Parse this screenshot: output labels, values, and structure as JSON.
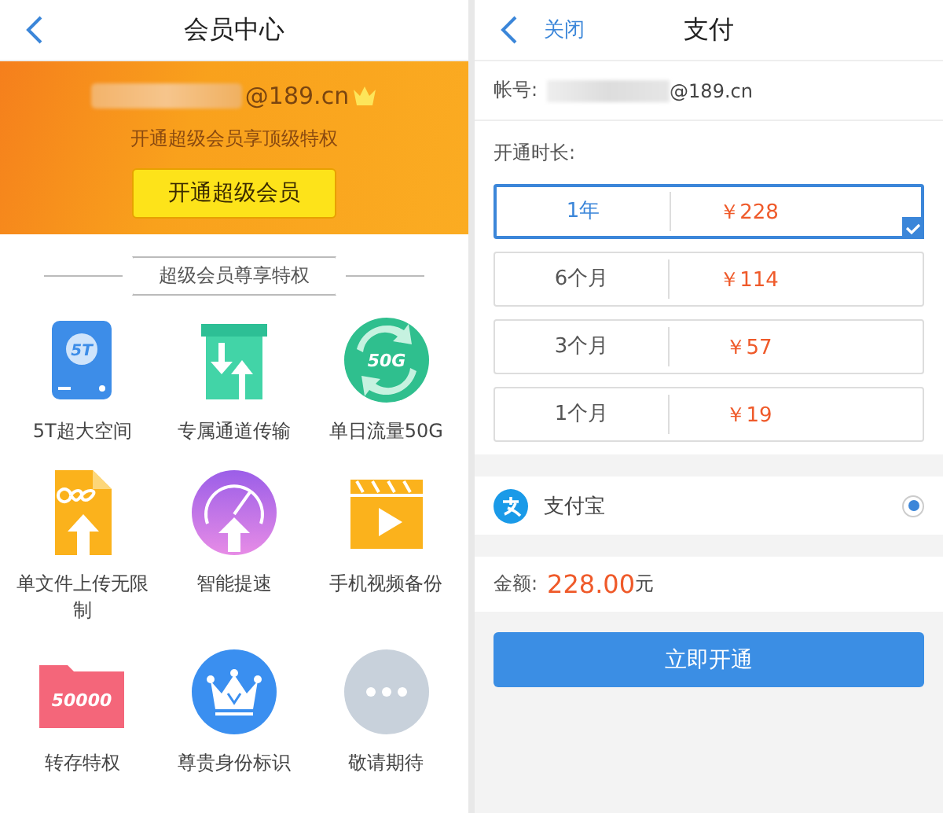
{
  "member_center": {
    "title": "会员中心",
    "account_suffix": "@189.cn",
    "subtitle": "开通超级会员享顶级特权",
    "cta": "开通超级会员",
    "section_title": "超级会员尊享特权",
    "features": [
      {
        "label": "5T超大空间",
        "kind": "drive",
        "icon_text": "5T"
      },
      {
        "label": "专属通道传输",
        "kind": "box"
      },
      {
        "label": "单日流量50G",
        "kind": "flow",
        "icon_text": "50G"
      },
      {
        "label": "单文件上传无限制",
        "kind": "file"
      },
      {
        "label": "智能提速",
        "kind": "speed"
      },
      {
        "label": "手机视频备份",
        "kind": "video"
      },
      {
        "label": "转存特权",
        "kind": "folder",
        "icon_text": "50000"
      },
      {
        "label": "尊贵身份标识",
        "kind": "crown"
      },
      {
        "label": "敬请期待",
        "kind": "more"
      }
    ]
  },
  "payment": {
    "close": "关闭",
    "title": "支付",
    "account_label": "帐号:",
    "account_suffix": "@189.cn",
    "duration_label": "开通时长:",
    "options": [
      {
        "duration": "1年",
        "price": "￥228",
        "selected": true
      },
      {
        "duration": "6个月",
        "price": "￥114",
        "selected": false
      },
      {
        "duration": "3个月",
        "price": "￥57",
        "selected": false
      },
      {
        "duration": "1个月",
        "price": "￥19",
        "selected": false
      }
    ],
    "methods": [
      {
        "name": "支付宝",
        "selected": true
      }
    ],
    "amount_label": "金额:",
    "amount": "228.00",
    "amount_unit": "元",
    "submit": "立即开通"
  }
}
